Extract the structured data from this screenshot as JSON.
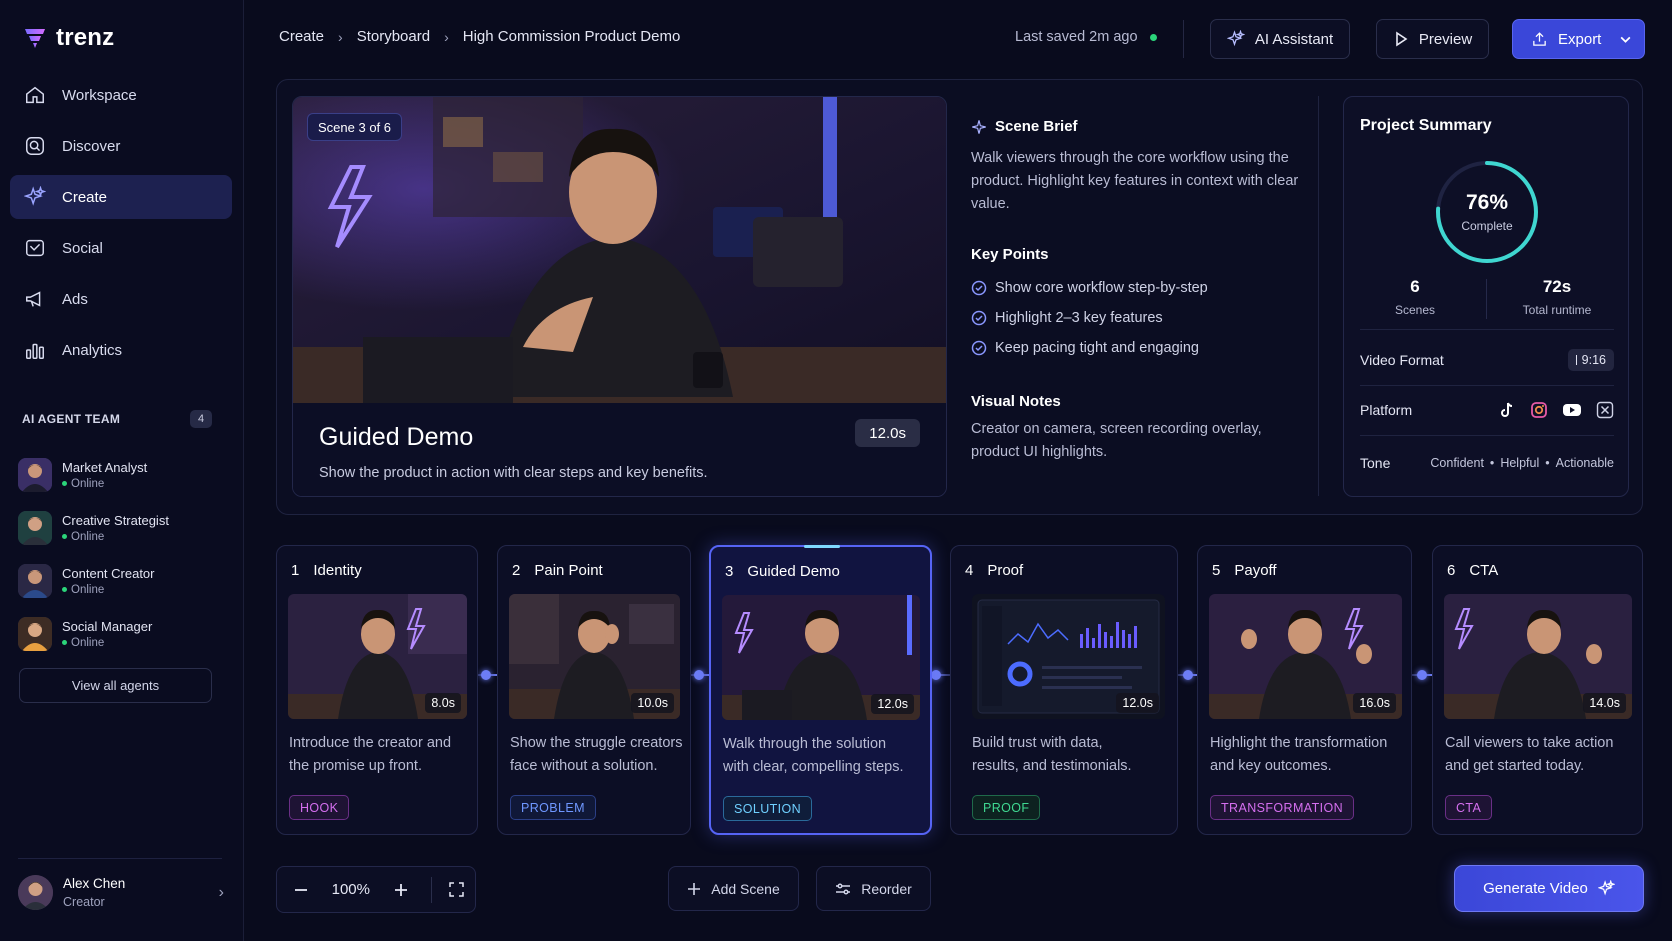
{
  "brand": {
    "name": "trenz"
  },
  "nav": [
    {
      "label": "Workspace",
      "icon": "home-icon"
    },
    {
      "label": "Discover",
      "icon": "discover-icon"
    },
    {
      "label": "Create",
      "icon": "sparkle-icon",
      "active": true
    },
    {
      "label": "Social",
      "icon": "social-icon"
    },
    {
      "label": "Ads",
      "icon": "megaphone-icon"
    },
    {
      "label": "Analytics",
      "icon": "bar-chart-icon"
    }
  ],
  "team": {
    "title": "AI AGENT TEAM",
    "count": "4",
    "agents": [
      {
        "name": "Market Analyst",
        "status": "Online"
      },
      {
        "name": "Creative Strategist",
        "status": "Online"
      },
      {
        "name": "Content Creator",
        "status": "Online"
      },
      {
        "name": "Social Manager",
        "status": "Online"
      }
    ],
    "view_all": "View all agents"
  },
  "user": {
    "name": "Alex Chen",
    "role": "Creator"
  },
  "breadcrumb": [
    "Create",
    "Storyboard",
    "High Commission Product Demo"
  ],
  "saved_status": "Last saved 2m ago",
  "toolbar": {
    "ai_assistant": "AI Assistant",
    "preview": "Preview",
    "export": "Export"
  },
  "hero": {
    "badge": "Scene 3 of 6",
    "title": "Guided Demo",
    "subtitle": "Show the product in action with clear steps and key benefits.",
    "duration": "12.0s"
  },
  "brief": {
    "title": "Scene Brief",
    "text": "Walk viewers through the core workflow using the product. Highlight key features in context with clear value.",
    "key_points_title": "Key Points",
    "key_points": [
      "Show core workflow step-by-step",
      "Highlight 2–3 key features",
      "Keep pacing tight and engaging"
    ],
    "visual_notes_title": "Visual Notes",
    "visual_notes": "Creator on camera, screen recording overlay, product UI highlights."
  },
  "summary": {
    "title": "Project Summary",
    "progress_pct": "76%",
    "progress_value": 0.76,
    "progress_label": "Complete",
    "scenes_val": "6",
    "scenes_label": "Scenes",
    "runtime_val": "72s",
    "runtime_label": "Total runtime",
    "format_label": "Video Format",
    "format_value": "9:16",
    "platform_label": "Platform",
    "platforms": [
      "tiktok-icon",
      "instagram-icon",
      "youtube-icon",
      "x-icon"
    ],
    "tone_label": "Tone",
    "tones": [
      "Confident",
      "Helpful",
      "Actionable"
    ],
    "tone_sep": "•"
  },
  "scenes": [
    {
      "num": "1",
      "title": "Identity",
      "duration": "8.0s",
      "desc": [
        "Introduce the creator and",
        "the promise up front."
      ],
      "tag": "HOOK",
      "tag_color": "#c456e8"
    },
    {
      "num": "2",
      "title": "Pain Point",
      "duration": "10.0s",
      "desc": [
        "Show the struggle creators",
        "face without a solution."
      ],
      "tag": "PROBLEM",
      "tag_color": "#5b8cf5"
    },
    {
      "num": "3",
      "title": "Guided Demo",
      "duration": "12.0s",
      "desc": [
        "Walk through the solution",
        "with clear, compelling steps."
      ],
      "tag": "SOLUTION",
      "tag_color": "#4fb6f0"
    },
    {
      "num": "4",
      "title": "Proof",
      "duration": "12.0s",
      "desc": [
        "Build trust with data,",
        "results, and testimonials."
      ],
      "tag": "PROOF",
      "tag_color": "#35d08a"
    },
    {
      "num": "5",
      "title": "Payoff",
      "duration": "16.0s",
      "desc": [
        "Highlight the transformation",
        "and key outcomes."
      ],
      "tag": "TRANSFORMATION",
      "tag_color": "#c456e8"
    },
    {
      "num": "6",
      "title": "CTA",
      "duration": "14.0s",
      "desc": [
        "Call viewers to take action",
        "and get started today."
      ],
      "tag": "CTA",
      "tag_color": "#c456e8"
    }
  ],
  "bottom": {
    "zoom": "100%",
    "add_scene": "Add Scene",
    "reorder": "Reorder",
    "generate": "Generate Video"
  },
  "colors": {
    "accent": "#3a47d9",
    "online": "#2bd57a",
    "progress": "#3fd6d0"
  }
}
